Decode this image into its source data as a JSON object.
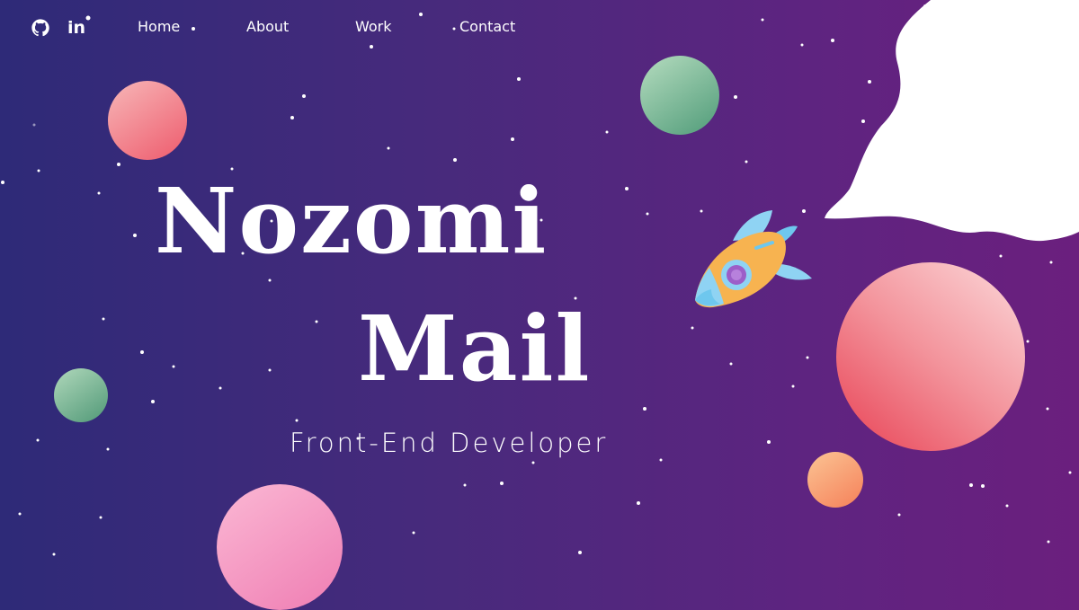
{
  "header": {
    "github_icon": "github-icon",
    "linkedin_label": "in",
    "nav": [
      {
        "label": "Home"
      },
      {
        "label": "About"
      },
      {
        "label": "Work"
      },
      {
        "label": "Contact"
      }
    ]
  },
  "hero": {
    "name_line1": "Nozomi",
    "name_line2": "Mail",
    "role": "Front-End Developer"
  },
  "colors": {
    "background_start": "#2e2a78",
    "background_end": "#6b1f7e",
    "planet_pink": "#f07a8a",
    "planet_green": "#6fb08c",
    "planet_orange": "#f8a06a",
    "cloud": "#ffffff"
  }
}
